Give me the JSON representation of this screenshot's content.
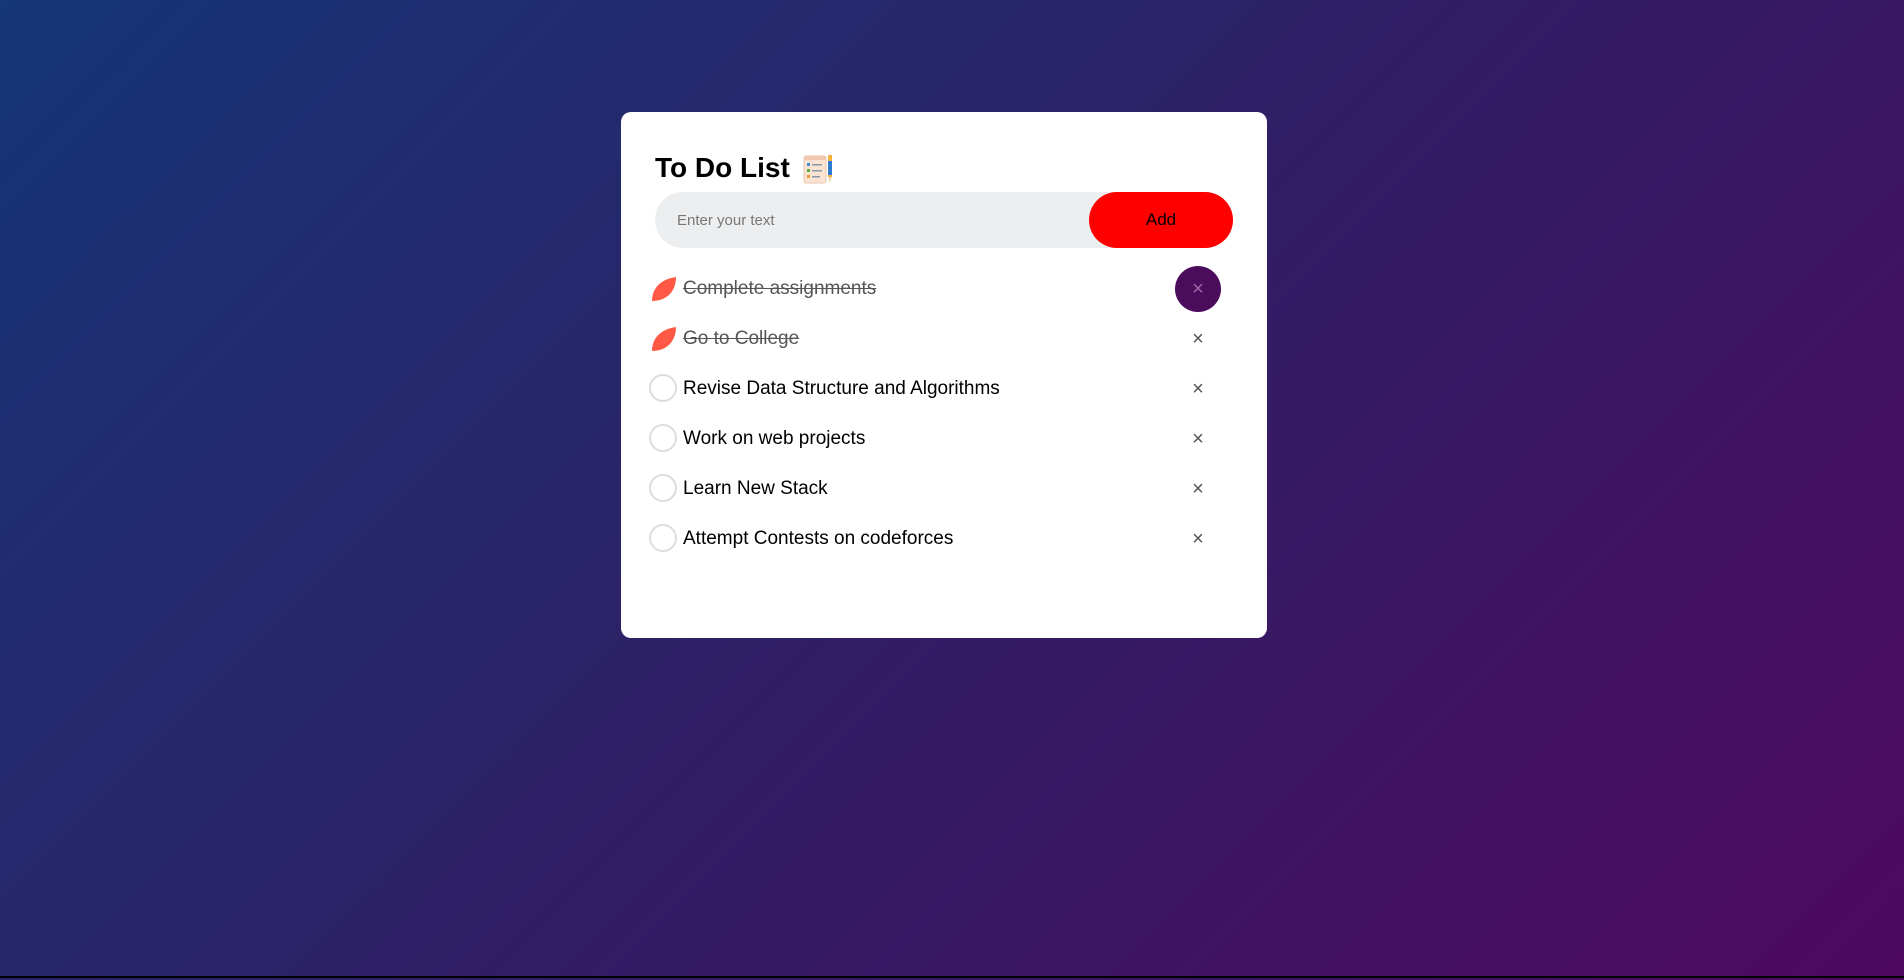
{
  "app": {
    "title": "To Do List",
    "title_icon": "checklist-notepad-icon"
  },
  "input": {
    "placeholder": "Enter your text",
    "value": ""
  },
  "add_button": {
    "label": "Add"
  },
  "tasks": [
    {
      "label": "Complete assignments",
      "checked": true
    },
    {
      "label": "Go to College",
      "checked": true
    },
    {
      "label": "Revise Data Structure and Algorithms",
      "checked": false
    },
    {
      "label": "Work on web projects",
      "checked": false
    },
    {
      "label": "Learn New Stack",
      "checked": false
    },
    {
      "label": "Attempt Contests on codeforces",
      "checked": false
    }
  ],
  "remove_glyph": "×",
  "colors": {
    "background_start": "#153677",
    "background_end": "#4e085f",
    "add_button": "#ff0000",
    "checked_mark": "#ff5945",
    "remove_hover": "#4b0c5c"
  }
}
